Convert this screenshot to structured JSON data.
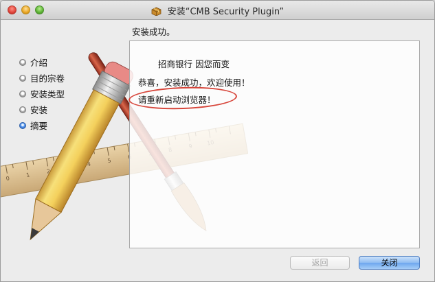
{
  "window": {
    "title": "安装“CMB Security Plugin”",
    "icons": [
      "close-icon",
      "minimize-icon",
      "zoom-icon",
      "package-icon"
    ]
  },
  "heading": "安装成功。",
  "steps": [
    {
      "label": "介绍",
      "active": false
    },
    {
      "label": "目的宗卷",
      "active": false
    },
    {
      "label": "安装类型",
      "active": false
    },
    {
      "label": "安装",
      "active": false
    },
    {
      "label": "摘要",
      "active": true
    }
  ],
  "content": {
    "line1": "招商银行 因您而变",
    "line2": "恭喜，安装成功，欢迎使用！",
    "line3": "请重新启动浏览器！"
  },
  "ruler_ticks": [
    "0",
    "1",
    "2",
    "3",
    "4",
    "5",
    "6",
    "7",
    "8",
    "9",
    "10"
  ],
  "buttons": {
    "back": "返回",
    "close": "关闭"
  },
  "colors": {
    "annotation": "#d7453a",
    "primary_button": "#6da6ee",
    "active_step": "#2a66c6"
  }
}
